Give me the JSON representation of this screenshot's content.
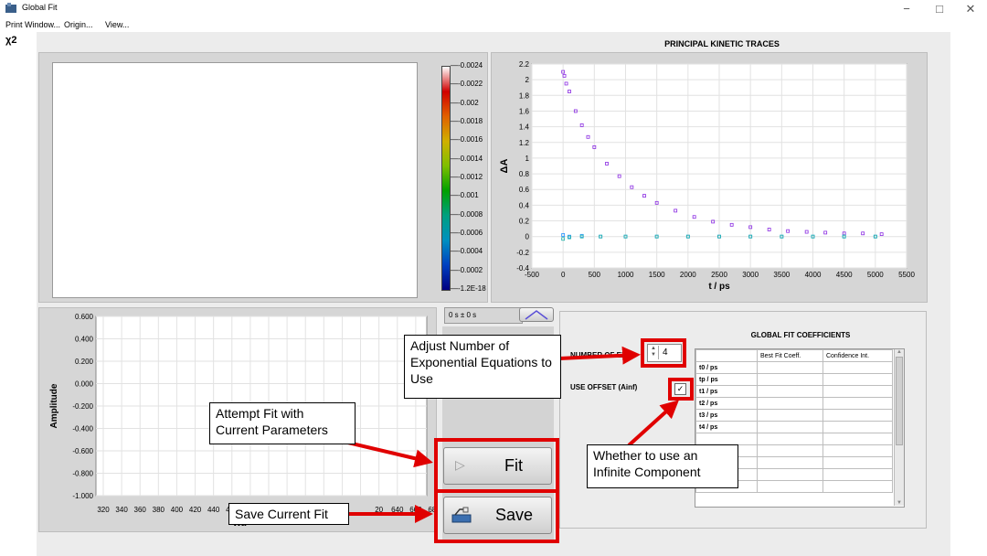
{
  "window": {
    "title": "Global Fit",
    "minimize": "−",
    "maximize": "□",
    "close": "✕"
  },
  "menu": [
    "Print Window...",
    "Origin...",
    "View..."
  ],
  "chi2_label": "χ2",
  "colorbar": {
    "ticks": [
      "-0.0024",
      "-0.0022",
      "-0.002",
      "-0.0018",
      "-0.0016",
      "-0.0014",
      "-0.0012",
      "-0.001",
      "-0.0008",
      "-0.0006",
      "-0.0004",
      "-0.0002",
      "-1.2E-18"
    ],
    "gradient": [
      "#ffffff",
      "#d00000",
      "#e06000",
      "#d0b000",
      "#7fbf00",
      "#00a000",
      "#00a080",
      "#0090c0",
      "#0040c0",
      "#000080"
    ]
  },
  "kinetics": {
    "title": "PRINCIPAL KINETIC TRACES",
    "ylabel": "ΔA",
    "xlabel": "t / ps",
    "yticks": [
      "2.2",
      "2",
      "1.8",
      "1.6",
      "1.4",
      "1.2",
      "1",
      "0.8",
      "0.6",
      "0.4",
      "0.2",
      "0",
      "-0.2",
      "-0.4"
    ],
    "xticks": [
      "-500",
      "0",
      "500",
      "1000",
      "1500",
      "2000",
      "2500",
      "3000",
      "3500",
      "4000",
      "4500",
      "5000",
      "5500"
    ]
  },
  "chart_data": {
    "type": "scatter",
    "title": "PRINCIPAL KINETIC TRACES",
    "xlabel": "t / ps",
    "ylabel": "ΔA",
    "xlim": [
      -500,
      5500
    ],
    "ylim": [
      -0.4,
      2.2
    ],
    "series": [
      {
        "color": "#8a2be2",
        "x": [
          0,
          20,
          50,
          100,
          200,
          300,
          400,
          500,
          700,
          900,
          1100,
          1300,
          1500,
          1800,
          2100,
          2400,
          2700,
          3000,
          3300,
          3600,
          3900,
          4200,
          4500,
          4800,
          5100
        ],
        "y": [
          2.1,
          2.05,
          1.95,
          1.85,
          1.6,
          1.42,
          1.27,
          1.14,
          0.93,
          0.77,
          0.63,
          0.52,
          0.43,
          0.33,
          0.25,
          0.19,
          0.15,
          0.12,
          0.09,
          0.07,
          0.06,
          0.05,
          0.04,
          0.04,
          0.03
        ]
      },
      {
        "color": "#1e90ff",
        "x": [
          0,
          100,
          300,
          600,
          1000,
          1500,
          2000,
          2500,
          3000,
          3500,
          4000,
          4500,
          5000
        ],
        "y": [
          0.02,
          0.0,
          0.01,
          0.0,
          0.0,
          0.0,
          0.0,
          0.0,
          0.0,
          0.0,
          0.0,
          0.0,
          0.0
        ]
      },
      {
        "color": "#20b2aa",
        "x": [
          0,
          100,
          300,
          600,
          1000,
          1500,
          2000,
          2500,
          3000,
          3500,
          4000,
          4500,
          5000
        ],
        "y": [
          -0.03,
          -0.01,
          0.0,
          0.0,
          0.0,
          0.0,
          0.0,
          0.0,
          0.0,
          0.0,
          0.0,
          0.0,
          0.0
        ]
      }
    ]
  },
  "amplitude": {
    "ylabel": "Amplitude",
    "yticks": [
      "0.600",
      "0.400",
      "0.200",
      "0.000",
      "-0.200",
      "-0.400",
      "-0.600",
      "-0.800",
      "-1.000"
    ],
    "xticks": [
      "320",
      "340",
      "360",
      "380",
      "400",
      "420",
      "440",
      "460",
      "640",
      "660",
      "680"
    ],
    "xticks_partial": "20",
    "xlabel_partial": "Wa"
  },
  "time_display": "0 s ± 0 s",
  "coefficients": {
    "title": "GLOBAL FIT COEFFICIENTS",
    "number_label": "NUMBER OF EXP.",
    "number_value": "4",
    "offset_label": "USE OFFSET (Ainf)",
    "headers": [
      "",
      "Best Fit Coeff.",
      "Confidence Int."
    ],
    "rows": [
      "t0 / ps",
      "tp / ps",
      "t1 / ps",
      "t2 / ps",
      "t3 / ps",
      "t4 / ps",
      "",
      "",
      "",
      "",
      ""
    ]
  },
  "buttons": {
    "fit": "Fit",
    "save": "Save"
  },
  "callouts": {
    "adjust": "Adjust Number of Exponential Equations to Use",
    "attempt": "Attempt Fit with Current Parameters",
    "save": "Save Current Fit",
    "whether": "Whether to use an Infinite Component"
  },
  "annotation_color": "#e00000"
}
